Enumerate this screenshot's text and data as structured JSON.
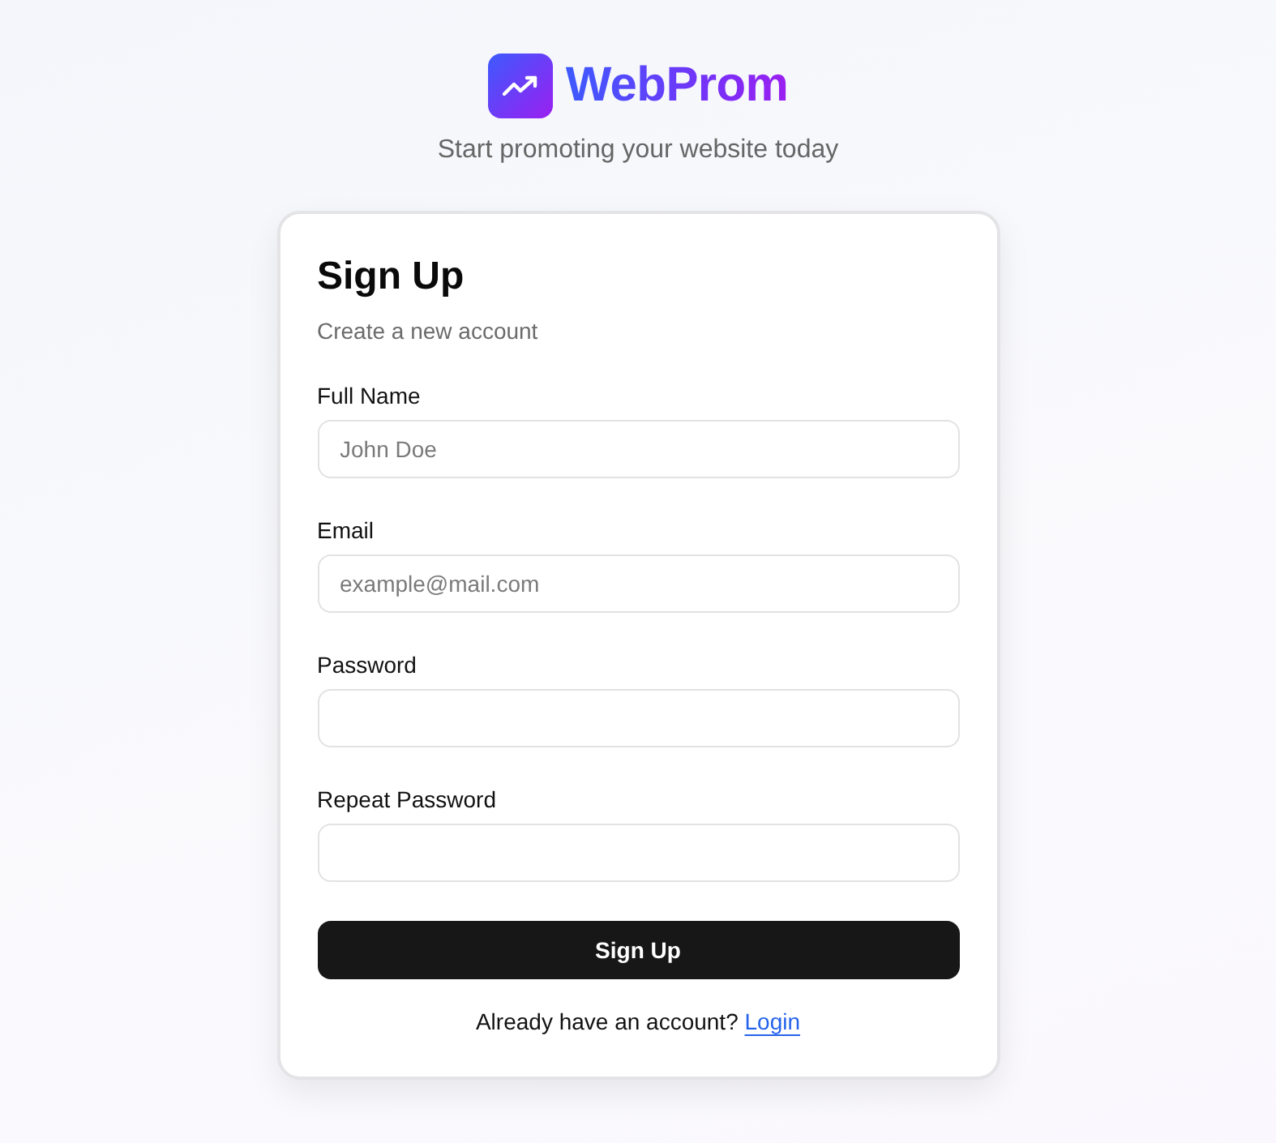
{
  "brand": {
    "name": "WebProm",
    "tagline": "Start promoting your website today"
  },
  "card": {
    "title": "Sign Up",
    "subtitle": "Create a new account"
  },
  "fields": [
    {
      "label": "Full Name",
      "placeholder": "John Doe"
    },
    {
      "label": "Email",
      "placeholder": "example@mail.com"
    },
    {
      "label": "Password"
    },
    {
      "label": "Repeat Password"
    }
  ],
  "submit": "Sign Up",
  "footer": {
    "text": "Already have an account?",
    "link": "Login"
  }
}
